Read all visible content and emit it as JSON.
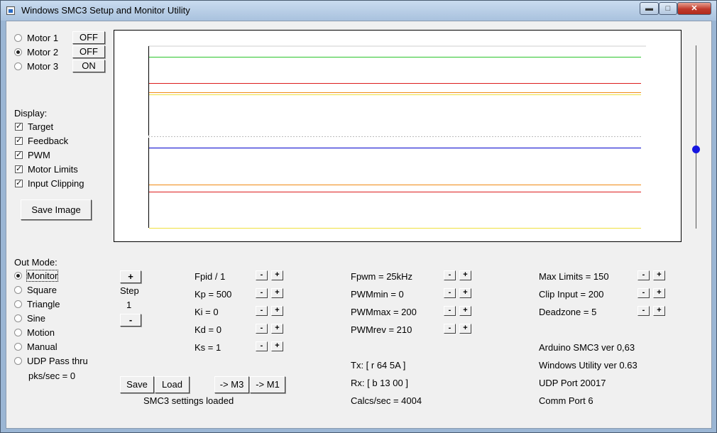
{
  "window": {
    "title": "Windows SMC3 Setup and Monitor Utility",
    "min_glyph": "▬",
    "max_glyph": "□",
    "close_glyph": "✕"
  },
  "motors": [
    {
      "label": "Motor 1",
      "state": "OFF",
      "selected": false
    },
    {
      "label": "Motor 2",
      "state": "OFF",
      "selected": true
    },
    {
      "label": "Motor 3",
      "state": "ON",
      "selected": false
    }
  ],
  "display": {
    "heading": "Display:",
    "options": [
      {
        "label": "Target",
        "checked": true
      },
      {
        "label": "Feedback",
        "checked": true
      },
      {
        "label": "PWM",
        "checked": true
      },
      {
        "label": "Motor Limits",
        "checked": true
      },
      {
        "label": "Input Clipping",
        "checked": true
      }
    ],
    "save_image_label": "Save Image",
    "check_glyph": "✓"
  },
  "out_mode": {
    "heading": "Out Mode:",
    "options": [
      {
        "label": "Monitor",
        "selected": true
      },
      {
        "label": "Square",
        "selected": false
      },
      {
        "label": "Triangle",
        "selected": false
      },
      {
        "label": "Sine",
        "selected": false
      },
      {
        "label": "Motion",
        "selected": false
      },
      {
        "label": "Manual",
        "selected": false
      },
      {
        "label": "UDP Pass thru",
        "selected": false
      }
    ],
    "pks_sec": "pks/sec = 0"
  },
  "step": {
    "plus_label": "+",
    "minus_label": "-",
    "label": "Step",
    "value": "1"
  },
  "pid": [
    {
      "label": "Fpid / 1"
    },
    {
      "label": "Kp = 500"
    },
    {
      "label": "Ki = 0"
    },
    {
      "label": "Kd = 0"
    },
    {
      "label": "Ks = 1"
    }
  ],
  "pwm": [
    {
      "label": "Fpwm = 25kHz"
    },
    {
      "label": "PWMmin = 0"
    },
    {
      "label": "PWMmax = 200"
    },
    {
      "label": "PWMrev = 210"
    }
  ],
  "limits": [
    {
      "label": "Max Limits = 150"
    },
    {
      "label": "Clip Input = 200"
    },
    {
      "label": "Deadzone = 5"
    }
  ],
  "adjust": {
    "minus": "-",
    "plus": "+"
  },
  "actions": {
    "save": "Save",
    "load": "Load",
    "to_m3": "-> M3",
    "to_m1": "-> M1"
  },
  "status": {
    "settings": "SMC3 settings loaded",
    "tx": "Tx: [ r 64 5A ]",
    "rx": "Rx: [ b 13 00 ]",
    "calcs": "Calcs/sec = 4004",
    "arduino_ver": "Arduino SMC3 ver 0,63",
    "windows_ver": "Windows Utility ver 0.63",
    "udp_port": "UDP Port 20017",
    "comm_port": "Comm Port 6"
  },
  "graph_traces": [
    {
      "id": "feedback-top",
      "color": "#2bc52b",
      "level": 0.94
    },
    {
      "id": "limit-top",
      "color": "#dd1d1d",
      "level": 0.795
    },
    {
      "id": "pwm-top-orange",
      "color": "#f08a14",
      "level": 0.745
    },
    {
      "id": "pwm-top-yellow",
      "color": "#f0e040",
      "level": 0.735
    },
    {
      "id": "target",
      "color": "#0000cc",
      "level": 0.44
    },
    {
      "id": "pwm-bottom-orange",
      "color": "#f08a14",
      "level": 0.24
    },
    {
      "id": "limit-bottom",
      "color": "#dd1d1d",
      "level": 0.2
    },
    {
      "id": "pwm-bottom-yellow",
      "color": "#f0e040",
      "level": 0.0
    }
  ],
  "colors": {
    "slider_thumb": "#1515e0",
    "close_button": "#c0392b"
  }
}
